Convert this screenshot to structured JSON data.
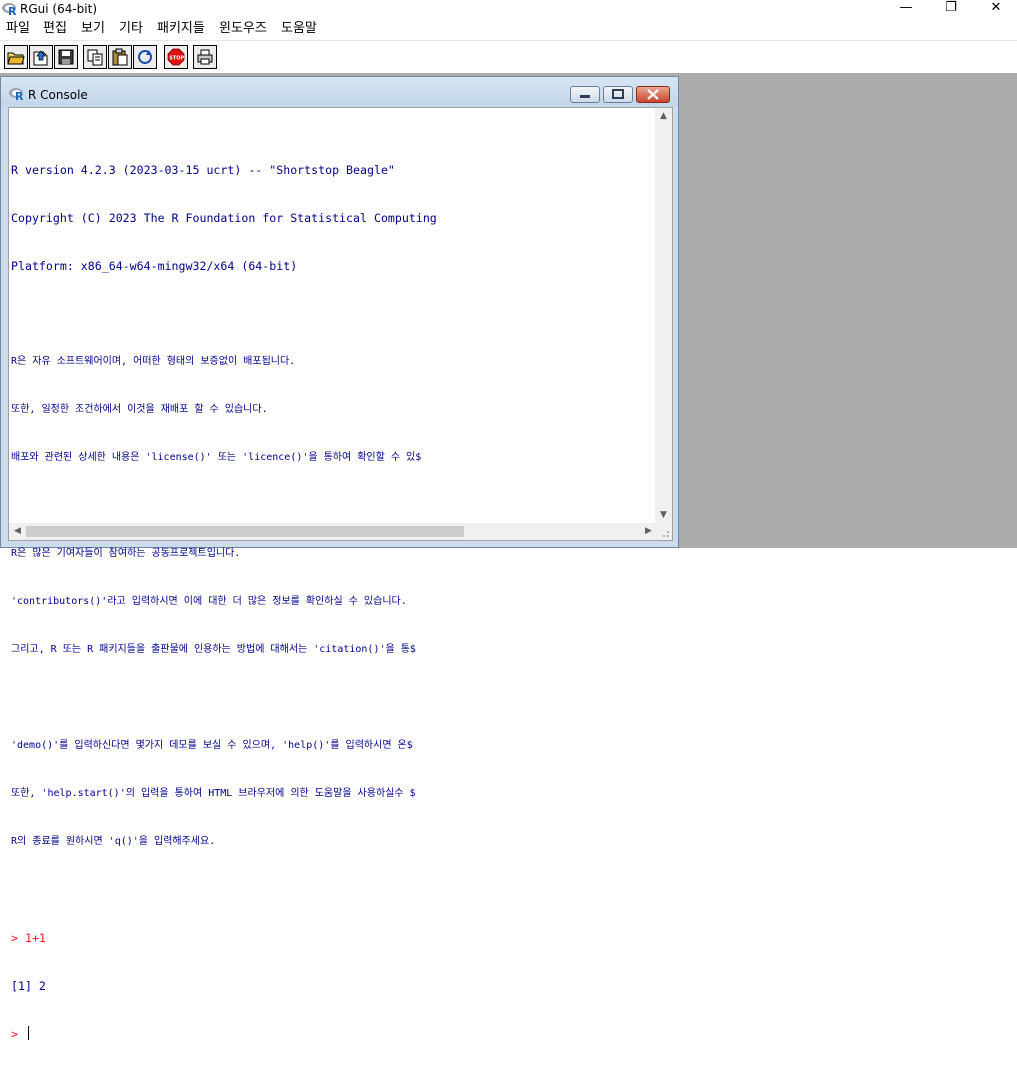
{
  "window": {
    "title": "RGui (64-bit)",
    "minimize": "—",
    "restore": "❐",
    "close": "✕"
  },
  "menu": [
    "파일",
    "편집",
    "보기",
    "기타",
    "패키지들",
    "윈도우즈",
    "도움말"
  ],
  "toolbar": {
    "buttons": [
      "open-script",
      "load-workspace",
      "save-workspace",
      "copy",
      "paste",
      "copy-paste",
      "stop",
      "print"
    ]
  },
  "console": {
    "title": "R Console",
    "lines": [
      "R version 4.2.3 (2023-03-15 ucrt) -- \"Shortstop Beagle\"",
      "Copyright (C) 2023 The R Foundation for Statistical Computing",
      "Platform: x86_64-w64-mingw32/x64 (64-bit)",
      "",
      "R은 자유 소프트웨어이며, 어떠한 형태의 보증없이 배포됩니다.",
      "또한, 일정한 조건하에서 이것을 재배포 할 수 있습니다.",
      "배포와 관련된 상세한 내용은 'license()' 또는 'licence()'을 통하여 확인할 수 있$",
      "",
      "R은 많은 기여자들이 참여하는 공동프로젝트입니다.",
      "'contributors()'라고 입력하시면 이에 대한 더 많은 정보를 확인하실 수 있습니다.",
      "그리고, R 또는 R 패키지들을 출판물에 인용하는 방법에 대해서는 'citation()'을 통$",
      "",
      "'demo()'를 입력하신다면 몇가지 데모를 보실 수 있으며, 'help()'를 입력하시면 온$",
      "또한, 'help.start()'의 입력을 통하여 HTML 브라우저에 의한 도움말을 사용하실수 $",
      "R의 종료를 원하시면 'q()'을 입력해주세요.",
      ""
    ],
    "input_prompt": "> ",
    "input_command": "1+1",
    "result": "[1] 2",
    "current_prompt": "> "
  },
  "colors": {
    "prompt": "#ff2020",
    "output": "#00008b",
    "mdi_background": "#ababab"
  }
}
